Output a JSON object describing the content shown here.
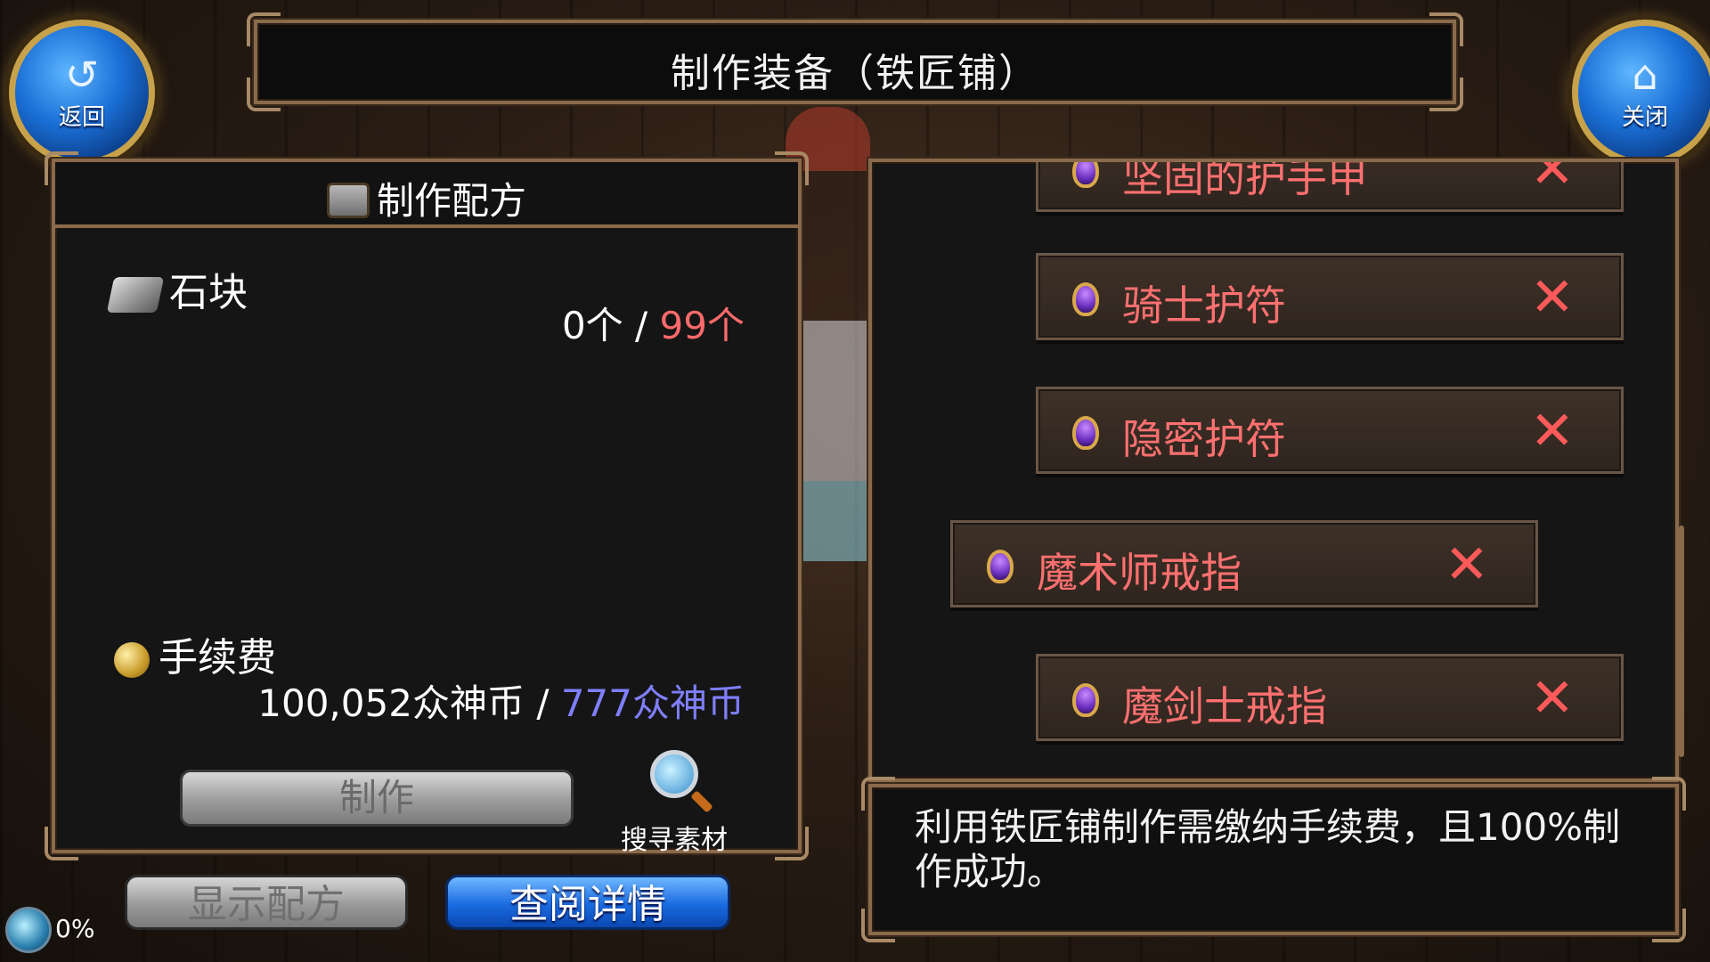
{
  "header": {
    "title": "制作装备（铁匠铺）",
    "back_label": "返回",
    "close_label": "关闭"
  },
  "recipe": {
    "section_title": "制作配方",
    "material_name": "石块",
    "material_have": "0个",
    "material_separator": "/",
    "material_need": "99个",
    "fee_label": "手续费",
    "fee_cost": "100,052众神币",
    "fee_separator": "/",
    "fee_owned": "777众神币",
    "make_label": "制作",
    "search_label": "搜寻素材"
  },
  "bottom": {
    "show_recipe_label": "显示配方",
    "view_details_label": "查阅详情",
    "progress_text": "0%"
  },
  "list": {
    "items": [
      {
        "label": "坚固的护手甲",
        "status": "✕",
        "icon": "ring-icon"
      },
      {
        "label": "骑士护符",
        "status": "✕",
        "icon": "ring-icon"
      },
      {
        "label": "隐密护符",
        "status": "✕",
        "icon": "ring-icon"
      },
      {
        "label": "魔术师戒指",
        "status": "✕",
        "icon": "ring-icon",
        "selected": true
      },
      {
        "label": "魔剑士戒指",
        "status": "✕",
        "icon": "ring-icon"
      }
    ]
  },
  "description": {
    "text": "利用铁匠铺制作需缴纳手续费，且100%制作成功。"
  },
  "colors": {
    "insufficient": "#ff6a6a",
    "currency_owned": "#7f7fff",
    "frame": "#8a6a4a",
    "primary_button": "#1a6ae0"
  }
}
